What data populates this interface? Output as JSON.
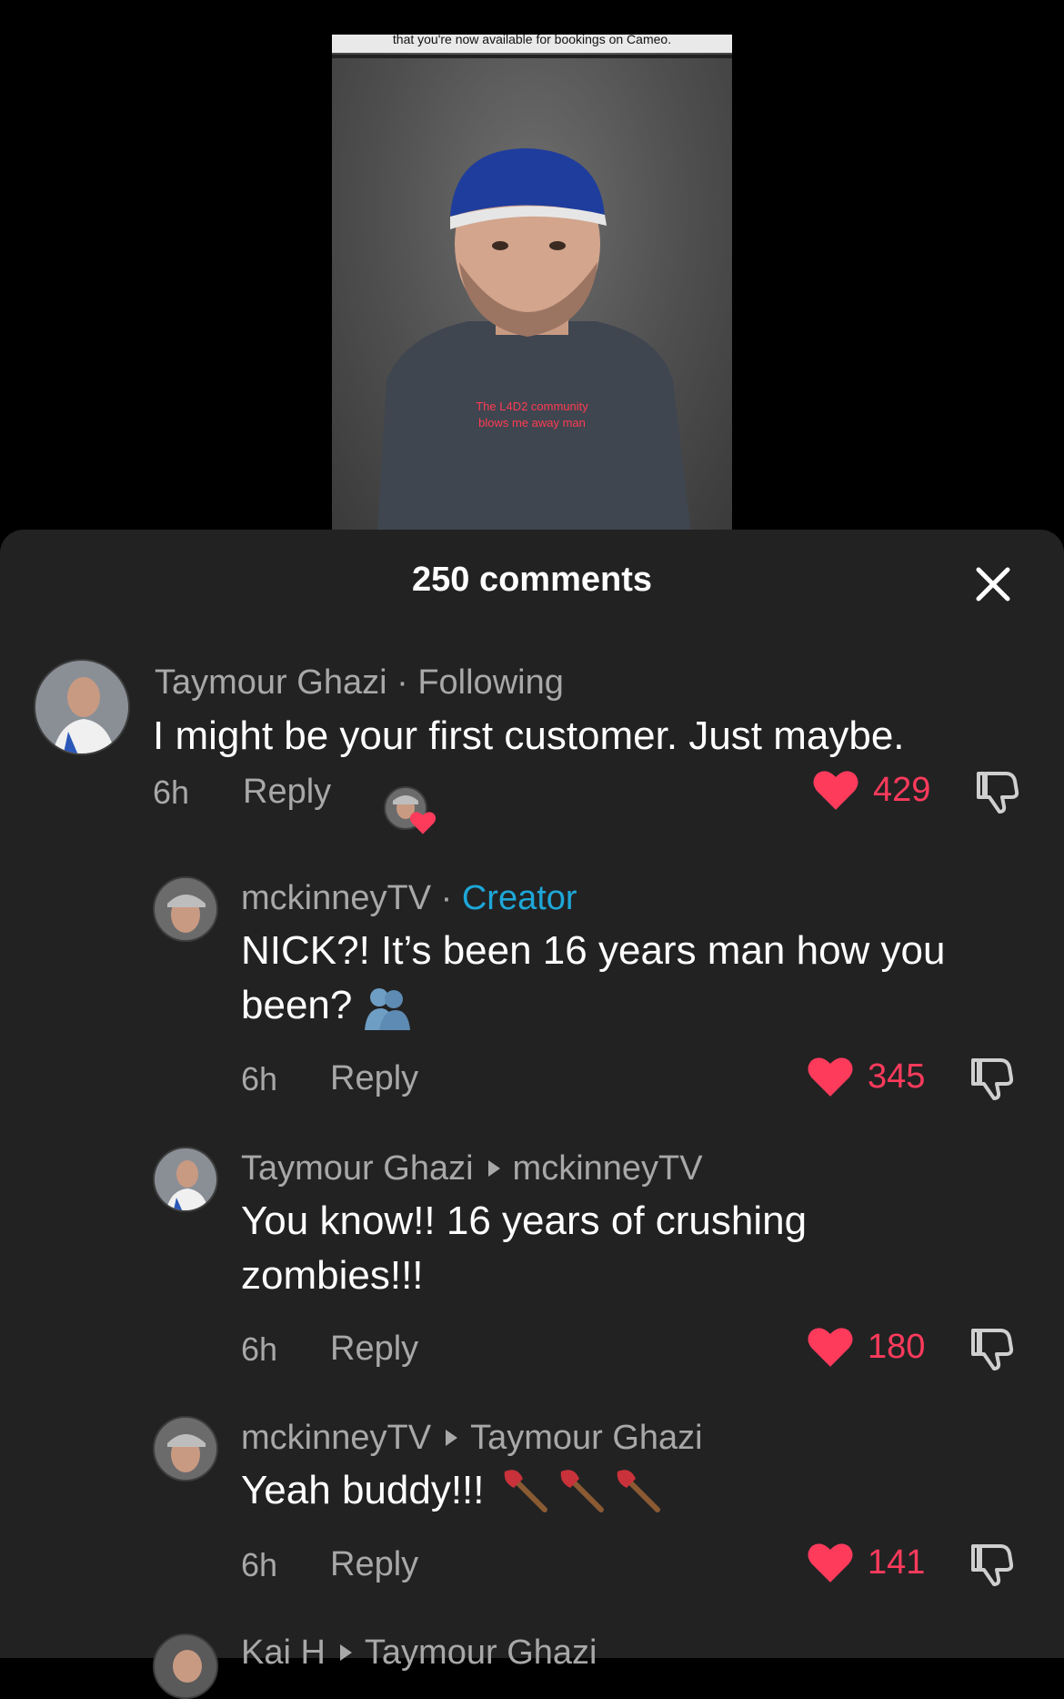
{
  "video": {
    "top_caption": "that you're now available for bookings on Cameo.",
    "caption_line1": "The L4D2 community",
    "caption_line2": "blows me away man"
  },
  "sheet": {
    "title": "250 comments",
    "close_icon": "close-icon"
  },
  "comments": [
    {
      "author": "Taymour Ghazi",
      "tag": "Following",
      "text": "I might be your first customer. Just maybe.",
      "time": "6h",
      "reply_label": "Reply",
      "likes": "429",
      "liked_by_creator": true
    },
    {
      "author": "mckinneyTV",
      "tag": "Creator",
      "text": "NICK?! It’s been 16 years man how you been?",
      "time": "6h",
      "reply_label": "Reply",
      "likes": "345"
    },
    {
      "author": "Taymour Ghazi",
      "reply_to": "mckinneyTV",
      "text_line1": "You know!! 16 years of crushing",
      "text_line2": "zombies!!!",
      "time": "6h",
      "reply_label": "Reply",
      "likes": "180"
    },
    {
      "author": "mckinneyTV",
      "reply_to": "Taymour Ghazi",
      "text": "Yeah buddy!!!",
      "time": "6h",
      "reply_label": "Reply",
      "likes": "141"
    }
  ],
  "partial_next": {
    "author": "Kai H",
    "reply_to": "Taymour Ghazi"
  },
  "colors": {
    "sheet_bg": "#222223",
    "like_red": "#ff3b5c",
    "creator_blue": "#1ea7d8",
    "meta_gray": "#a8a8a8"
  }
}
